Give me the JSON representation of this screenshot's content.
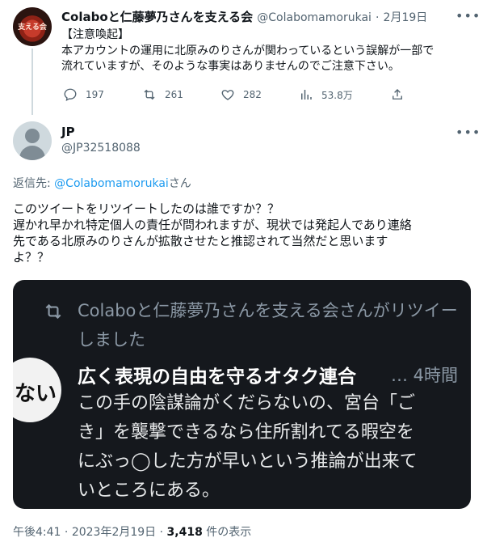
{
  "parent_tweet": {
    "display_name": "Colaboと仁藤夢乃さんを支える会",
    "handle": "@Colabomamorukai",
    "date": "2月19日",
    "avatar_text": "支える会",
    "body_line1": "【注意喚起】",
    "body_line2": "本アカウントの運用に北原みのりさんが関わっているという誤解が一部で",
    "body_line3": "流れていますが、そのような事実はありませんのでご注意下さい。",
    "replies": "197",
    "retweets": "261",
    "likes": "282",
    "views": "53.8万"
  },
  "reply_tweet": {
    "display_name": "JP",
    "handle": "@JP32518088",
    "reply_to_prefix": "返信先: ",
    "reply_to_handle": "@Colabomamorukai",
    "reply_to_suffix": "さん",
    "text_lines": [
      "このツイートをリツイートしたのは誰ですか？？",
      "遅かれ早かれ特定個人の責任が問われますが、現状では発起人であり連絡",
      "先である北原みのりさんが拡散させたと推認されて当然だと思います",
      "よ？？"
    ]
  },
  "embedded_screenshot": {
    "retweet_line1": "Colaboと仁藤夢乃さんを支える会さんがリツイー",
    "retweet_line2": "しました",
    "avatar_text": "ない",
    "quoted_name": "広く表現の自由を守るオタク連合",
    "quoted_meta": "… 4時間",
    "quoted_lines": [
      "この手の陰謀論がくだらないの、宮台「ご",
      "き」を襲撃できるなら住所割れてる暇空を",
      "にぶっ◯した方が早いという推論が出来て",
      "いところにある。"
    ]
  },
  "footer": {
    "time": "午後4:41",
    "separator": " · ",
    "date": "2023年2月19日",
    "views_count": "3,418",
    "views_label": " 件の表示"
  },
  "colors": {
    "link": "#1d9bf0",
    "muted": "#536471",
    "embed_bg": "#15181d"
  }
}
